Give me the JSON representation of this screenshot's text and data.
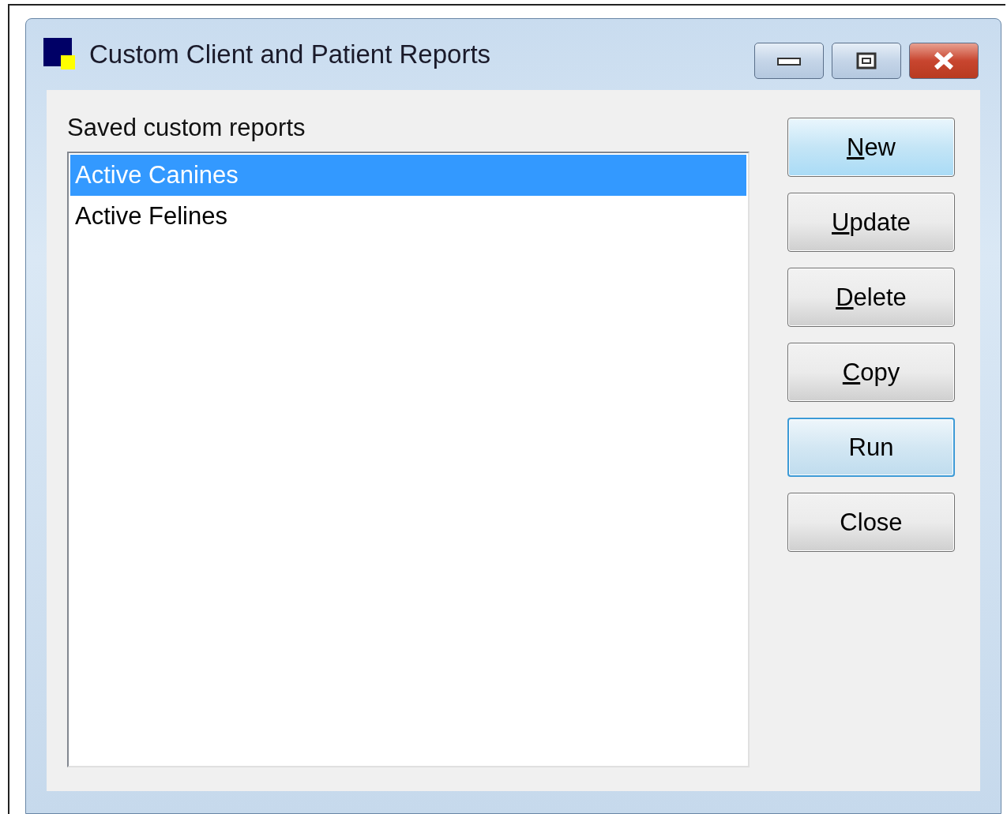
{
  "window": {
    "title": "Custom Client and Patient Reports",
    "controls": [
      {
        "kind": "minimize"
      },
      {
        "kind": "maximize"
      },
      {
        "kind": "close"
      }
    ]
  },
  "list": {
    "label": "Saved custom reports",
    "items": [
      {
        "text": "Active Canines",
        "selected": true
      },
      {
        "text": "Active Felines",
        "selected": false
      }
    ]
  },
  "buttons": [
    {
      "label": "New",
      "underline_first": true,
      "hot": true,
      "default": false
    },
    {
      "label": "Update",
      "underline_first": true,
      "hot": false,
      "default": false
    },
    {
      "label": "Delete",
      "underline_first": true,
      "hot": false,
      "default": false
    },
    {
      "label": "Copy",
      "underline_first": true,
      "hot": false,
      "default": false
    },
    {
      "label": "Run",
      "underline_first": false,
      "hot": false,
      "default": true
    },
    {
      "label": "Close",
      "underline_first": false,
      "hot": false,
      "default": false
    }
  ]
}
